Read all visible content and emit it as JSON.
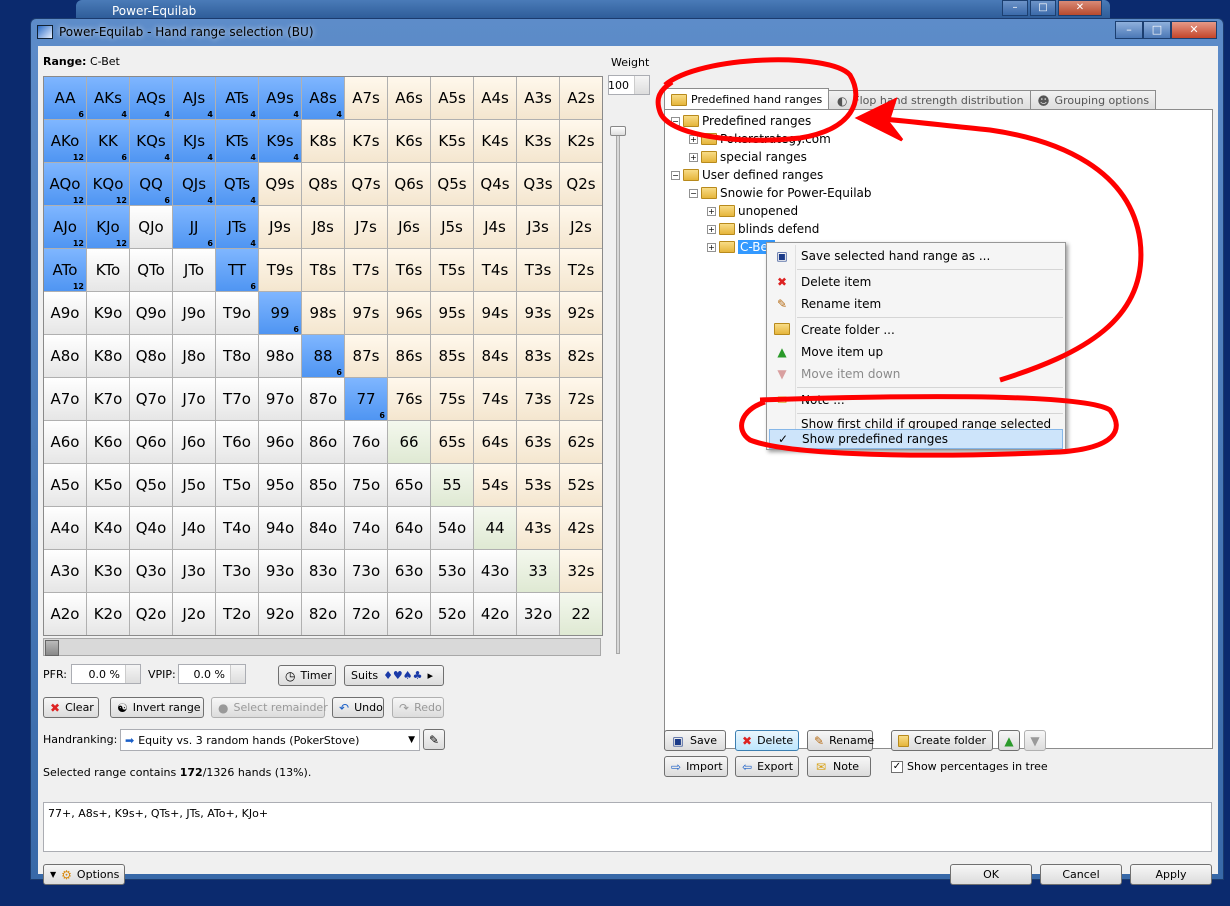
{
  "bg_window": {
    "title": "Power-Equilab"
  },
  "window": {
    "title": "Power-Equilab - Hand range selection (BU)"
  },
  "range": {
    "label": "Range:",
    "name": "C-Bet"
  },
  "weight": {
    "label": "Weight",
    "value": "100"
  },
  "grid": [
    [
      {
        "h": "AA",
        "c": "6",
        "t": "sel"
      },
      {
        "h": "AKs",
        "c": "4",
        "t": "sel"
      },
      {
        "h": "AQs",
        "c": "4",
        "t": "sel"
      },
      {
        "h": "AJs",
        "c": "4",
        "t": "sel"
      },
      {
        "h": "ATs",
        "c": "4",
        "t": "sel"
      },
      {
        "h": "A9s",
        "c": "4",
        "t": "sel"
      },
      {
        "h": "A8s",
        "c": "4",
        "t": "sel"
      },
      {
        "h": "A7s",
        "t": "s"
      },
      {
        "h": "A6s",
        "t": "s"
      },
      {
        "h": "A5s",
        "t": "s"
      },
      {
        "h": "A4s",
        "t": "s"
      },
      {
        "h": "A3s",
        "t": "s"
      },
      {
        "h": "A2s",
        "t": "s"
      }
    ],
    [
      {
        "h": "AKo",
        "c": "12",
        "t": "sel"
      },
      {
        "h": "KK",
        "c": "6",
        "t": "sel"
      },
      {
        "h": "KQs",
        "c": "4",
        "t": "sel"
      },
      {
        "h": "KJs",
        "c": "4",
        "t": "sel"
      },
      {
        "h": "KTs",
        "c": "4",
        "t": "sel"
      },
      {
        "h": "K9s",
        "c": "4",
        "t": "sel"
      },
      {
        "h": "K8s",
        "t": "s"
      },
      {
        "h": "K7s",
        "t": "s"
      },
      {
        "h": "K6s",
        "t": "s"
      },
      {
        "h": "K5s",
        "t": "s"
      },
      {
        "h": "K4s",
        "t": "s"
      },
      {
        "h": "K3s",
        "t": "s"
      },
      {
        "h": "K2s",
        "t": "s"
      }
    ],
    [
      {
        "h": "AQo",
        "c": "12",
        "t": "sel"
      },
      {
        "h": "KQo",
        "c": "12",
        "t": "sel"
      },
      {
        "h": "QQ",
        "c": "6",
        "t": "sel"
      },
      {
        "h": "QJs",
        "c": "4",
        "t": "sel"
      },
      {
        "h": "QTs",
        "c": "4",
        "t": "sel"
      },
      {
        "h": "Q9s",
        "t": "s"
      },
      {
        "h": "Q8s",
        "t": "s"
      },
      {
        "h": "Q7s",
        "t": "s"
      },
      {
        "h": "Q6s",
        "t": "s"
      },
      {
        "h": "Q5s",
        "t": "s"
      },
      {
        "h": "Q4s",
        "t": "s"
      },
      {
        "h": "Q3s",
        "t": "s"
      },
      {
        "h": "Q2s",
        "t": "s"
      }
    ],
    [
      {
        "h": "AJo",
        "c": "12",
        "t": "sel"
      },
      {
        "h": "KJo",
        "c": "12",
        "t": "sel"
      },
      {
        "h": "QJo",
        "t": "o"
      },
      {
        "h": "JJ",
        "c": "6",
        "t": "sel"
      },
      {
        "h": "JTs",
        "c": "4",
        "t": "sel"
      },
      {
        "h": "J9s",
        "t": "s"
      },
      {
        "h": "J8s",
        "t": "s"
      },
      {
        "h": "J7s",
        "t": "s"
      },
      {
        "h": "J6s",
        "t": "s"
      },
      {
        "h": "J5s",
        "t": "s"
      },
      {
        "h": "J4s",
        "t": "s"
      },
      {
        "h": "J3s",
        "t": "s"
      },
      {
        "h": "J2s",
        "t": "s"
      }
    ],
    [
      {
        "h": "ATo",
        "c": "12",
        "t": "sel"
      },
      {
        "h": "KTo",
        "t": "o"
      },
      {
        "h": "QTo",
        "t": "o"
      },
      {
        "h": "JTo",
        "t": "o"
      },
      {
        "h": "TT",
        "c": "6",
        "t": "sel"
      },
      {
        "h": "T9s",
        "t": "s"
      },
      {
        "h": "T8s",
        "t": "s"
      },
      {
        "h": "T7s",
        "t": "s"
      },
      {
        "h": "T6s",
        "t": "s"
      },
      {
        "h": "T5s",
        "t": "s"
      },
      {
        "h": "T4s",
        "t": "s"
      },
      {
        "h": "T3s",
        "t": "s"
      },
      {
        "h": "T2s",
        "t": "s"
      }
    ],
    [
      {
        "h": "A9o",
        "t": "o"
      },
      {
        "h": "K9o",
        "t": "o"
      },
      {
        "h": "Q9o",
        "t": "o"
      },
      {
        "h": "J9o",
        "t": "o"
      },
      {
        "h": "T9o",
        "t": "o"
      },
      {
        "h": "99",
        "c": "6",
        "t": "sel"
      },
      {
        "h": "98s",
        "t": "s"
      },
      {
        "h": "97s",
        "t": "s"
      },
      {
        "h": "96s",
        "t": "s"
      },
      {
        "h": "95s",
        "t": "s"
      },
      {
        "h": "94s",
        "t": "s"
      },
      {
        "h": "93s",
        "t": "s"
      },
      {
        "h": "92s",
        "t": "s"
      }
    ],
    [
      {
        "h": "A8o",
        "t": "o"
      },
      {
        "h": "K8o",
        "t": "o"
      },
      {
        "h": "Q8o",
        "t": "o"
      },
      {
        "h": "J8o",
        "t": "o"
      },
      {
        "h": "T8o",
        "t": "o"
      },
      {
        "h": "98o",
        "t": "o"
      },
      {
        "h": "88",
        "c": "6",
        "t": "sel"
      },
      {
        "h": "87s",
        "t": "s"
      },
      {
        "h": "86s",
        "t": "s"
      },
      {
        "h": "85s",
        "t": "s"
      },
      {
        "h": "84s",
        "t": "s"
      },
      {
        "h": "83s",
        "t": "s"
      },
      {
        "h": "82s",
        "t": "s"
      }
    ],
    [
      {
        "h": "A7o",
        "t": "o"
      },
      {
        "h": "K7o",
        "t": "o"
      },
      {
        "h": "Q7o",
        "t": "o"
      },
      {
        "h": "J7o",
        "t": "o"
      },
      {
        "h": "T7o",
        "t": "o"
      },
      {
        "h": "97o",
        "t": "o"
      },
      {
        "h": "87o",
        "t": "o"
      },
      {
        "h": "77",
        "c": "6",
        "t": "sel"
      },
      {
        "h": "76s",
        "t": "s"
      },
      {
        "h": "75s",
        "t": "s"
      },
      {
        "h": "74s",
        "t": "s"
      },
      {
        "h": "73s",
        "t": "s"
      },
      {
        "h": "72s",
        "t": "s"
      }
    ],
    [
      {
        "h": "A6o",
        "t": "o"
      },
      {
        "h": "K6o",
        "t": "o"
      },
      {
        "h": "Q6o",
        "t": "o"
      },
      {
        "h": "J6o",
        "t": "o"
      },
      {
        "h": "T6o",
        "t": "o"
      },
      {
        "h": "96o",
        "t": "o"
      },
      {
        "h": "86o",
        "t": "o"
      },
      {
        "h": "76o",
        "t": "o"
      },
      {
        "h": "66",
        "t": "p"
      },
      {
        "h": "65s",
        "t": "s"
      },
      {
        "h": "64s",
        "t": "s"
      },
      {
        "h": "63s",
        "t": "s"
      },
      {
        "h": "62s",
        "t": "s"
      }
    ],
    [
      {
        "h": "A5o",
        "t": "o"
      },
      {
        "h": "K5o",
        "t": "o"
      },
      {
        "h": "Q5o",
        "t": "o"
      },
      {
        "h": "J5o",
        "t": "o"
      },
      {
        "h": "T5o",
        "t": "o"
      },
      {
        "h": "95o",
        "t": "o"
      },
      {
        "h": "85o",
        "t": "o"
      },
      {
        "h": "75o",
        "t": "o"
      },
      {
        "h": "65o",
        "t": "o"
      },
      {
        "h": "55",
        "t": "p"
      },
      {
        "h": "54s",
        "t": "s"
      },
      {
        "h": "53s",
        "t": "s"
      },
      {
        "h": "52s",
        "t": "s"
      }
    ],
    [
      {
        "h": "A4o",
        "t": "o"
      },
      {
        "h": "K4o",
        "t": "o"
      },
      {
        "h": "Q4o",
        "t": "o"
      },
      {
        "h": "J4o",
        "t": "o"
      },
      {
        "h": "T4o",
        "t": "o"
      },
      {
        "h": "94o",
        "t": "o"
      },
      {
        "h": "84o",
        "t": "o"
      },
      {
        "h": "74o",
        "t": "o"
      },
      {
        "h": "64o",
        "t": "o"
      },
      {
        "h": "54o",
        "t": "o"
      },
      {
        "h": "44",
        "t": "p"
      },
      {
        "h": "43s",
        "t": "s"
      },
      {
        "h": "42s",
        "t": "s"
      }
    ],
    [
      {
        "h": "A3o",
        "t": "o"
      },
      {
        "h": "K3o",
        "t": "o"
      },
      {
        "h": "Q3o",
        "t": "o"
      },
      {
        "h": "J3o",
        "t": "o"
      },
      {
        "h": "T3o",
        "t": "o"
      },
      {
        "h": "93o",
        "t": "o"
      },
      {
        "h": "83o",
        "t": "o"
      },
      {
        "h": "73o",
        "t": "o"
      },
      {
        "h": "63o",
        "t": "o"
      },
      {
        "h": "53o",
        "t": "o"
      },
      {
        "h": "43o",
        "t": "o"
      },
      {
        "h": "33",
        "t": "p"
      },
      {
        "h": "32s",
        "t": "s"
      }
    ],
    [
      {
        "h": "A2o",
        "t": "o"
      },
      {
        "h": "K2o",
        "t": "o"
      },
      {
        "h": "Q2o",
        "t": "o"
      },
      {
        "h": "J2o",
        "t": "o"
      },
      {
        "h": "T2o",
        "t": "o"
      },
      {
        "h": "92o",
        "t": "o"
      },
      {
        "h": "82o",
        "t": "o"
      },
      {
        "h": "72o",
        "t": "o"
      },
      {
        "h": "62o",
        "t": "o"
      },
      {
        "h": "52o",
        "t": "o"
      },
      {
        "h": "42o",
        "t": "o"
      },
      {
        "h": "32o",
        "t": "o"
      },
      {
        "h": "22",
        "t": "p"
      }
    ]
  ],
  "stats": {
    "pfr_label": "PFR:",
    "pfr_value": "0.0 %",
    "vpip_label": "VPIP:",
    "vpip_value": "0.0 %"
  },
  "buttons": {
    "timer": "Timer",
    "suits": "Suits",
    "suit_symbols": "♦♥♠♣",
    "clear": "Clear",
    "invert": "Invert range",
    "select_remainder": "Select remainder",
    "undo": "Undo",
    "redo": "Redo",
    "options": "Options",
    "ok": "OK",
    "cancel": "Cancel",
    "apply": "Apply"
  },
  "handranking": {
    "label": "Handranking:",
    "value": "Equity vs. 3 random hands (PokerStove)"
  },
  "selection": {
    "prefix": "Selected range contains ",
    "count": "172",
    "suffix": "/1326 hands (13%)."
  },
  "range_text": "77+, A8s+, K9s+, QTs+, JTs, ATo+, KJo+",
  "tabs": [
    {
      "label": "Predefined hand ranges"
    },
    {
      "label": "Flop hand strength distribution"
    },
    {
      "label": "Grouping options"
    }
  ],
  "tree": {
    "predefined": "Predefined ranges",
    "pokerstrategy": "Pokerstrategy.com",
    "special": "special ranges",
    "user_defined": "User defined ranges",
    "snowie": "Snowie for Power-Equilab",
    "unopened": "unopened",
    "blinds": "blinds defend",
    "cbet": "C-Bet"
  },
  "context_menu": {
    "save_as": "Save selected hand range as ...",
    "delete": "Delete item",
    "rename": "Rename item",
    "create_folder": "Create folder ...",
    "move_up": "Move item up",
    "move_down": "Move item down",
    "note": "Note ...",
    "show_first_child": "Show first child if grouped range selected",
    "show_predefined": "Show predefined ranges"
  },
  "tree_buttons": {
    "save": "Save",
    "delete": "Delete",
    "rename": "Rename",
    "create_folder": "Create folder",
    "import": "Import",
    "export": "Export",
    "note": "Note",
    "show_percentages": "Show percentages in tree"
  },
  "colors": {
    "selected": "#4f95f2",
    "suited": "#f4e6cf",
    "pair": "#dfe9d3",
    "annotation": "#ff0000"
  }
}
